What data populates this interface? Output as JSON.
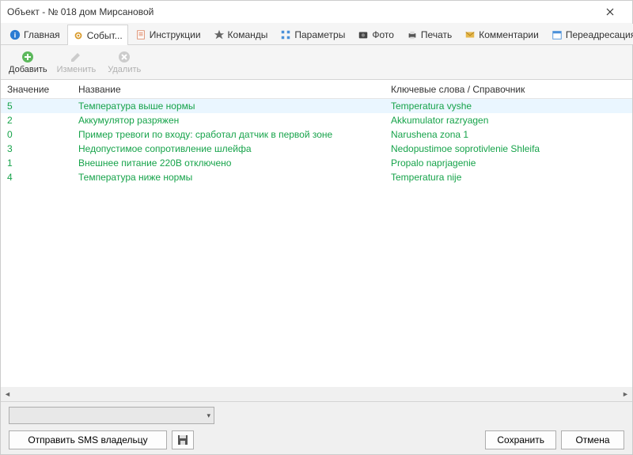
{
  "window": {
    "title": "Объект - № 018 дом Мирсановой"
  },
  "tabs": [
    {
      "label": "Главная",
      "icon": "info"
    },
    {
      "label": "Событ...",
      "icon": "gear",
      "active": true
    },
    {
      "label": "Инструкции",
      "icon": "doc"
    },
    {
      "label": "Команды",
      "icon": "star"
    },
    {
      "label": "Параметры",
      "icon": "grid"
    },
    {
      "label": "Фото",
      "icon": "camera"
    },
    {
      "label": "Печать",
      "icon": "printer"
    },
    {
      "label": "Комментарии",
      "icon": "envelope"
    },
    {
      "label": "Переадресация",
      "icon": "calendar"
    }
  ],
  "toolbar": {
    "add": "Добавить",
    "edit": "Изменить",
    "delete": "Удалить"
  },
  "table": {
    "headers": {
      "value": "Значение",
      "name": "Название",
      "keywords": "Ключевые слова / Справочник"
    },
    "rows": [
      {
        "v": "5",
        "n": "Температура выше нормы",
        "k": "Temperatura vyshe",
        "sel": true
      },
      {
        "v": "2",
        "n": "Аккумулятор разряжен",
        "k": "Akkumulator razryagen"
      },
      {
        "v": "0",
        "n": "Пример тревоги по входу: сработал датчик в первой зоне",
        "k": "Narushena zona 1"
      },
      {
        "v": "3",
        "n": "Недопустимое сопротивление шлейфа",
        "k": "Nedopustimoe soprotivlenie Shleifa"
      },
      {
        "v": "1",
        "n": "Внешнее питание 220В отключено",
        "k": "Propalo naprjagenie"
      },
      {
        "v": "4",
        "n": "Температура ниже нормы",
        "k": "Temperatura nije"
      }
    ]
  },
  "footer": {
    "sms": "Отправить SMS владельцу",
    "save": "Сохранить",
    "cancel": "Отмена"
  }
}
